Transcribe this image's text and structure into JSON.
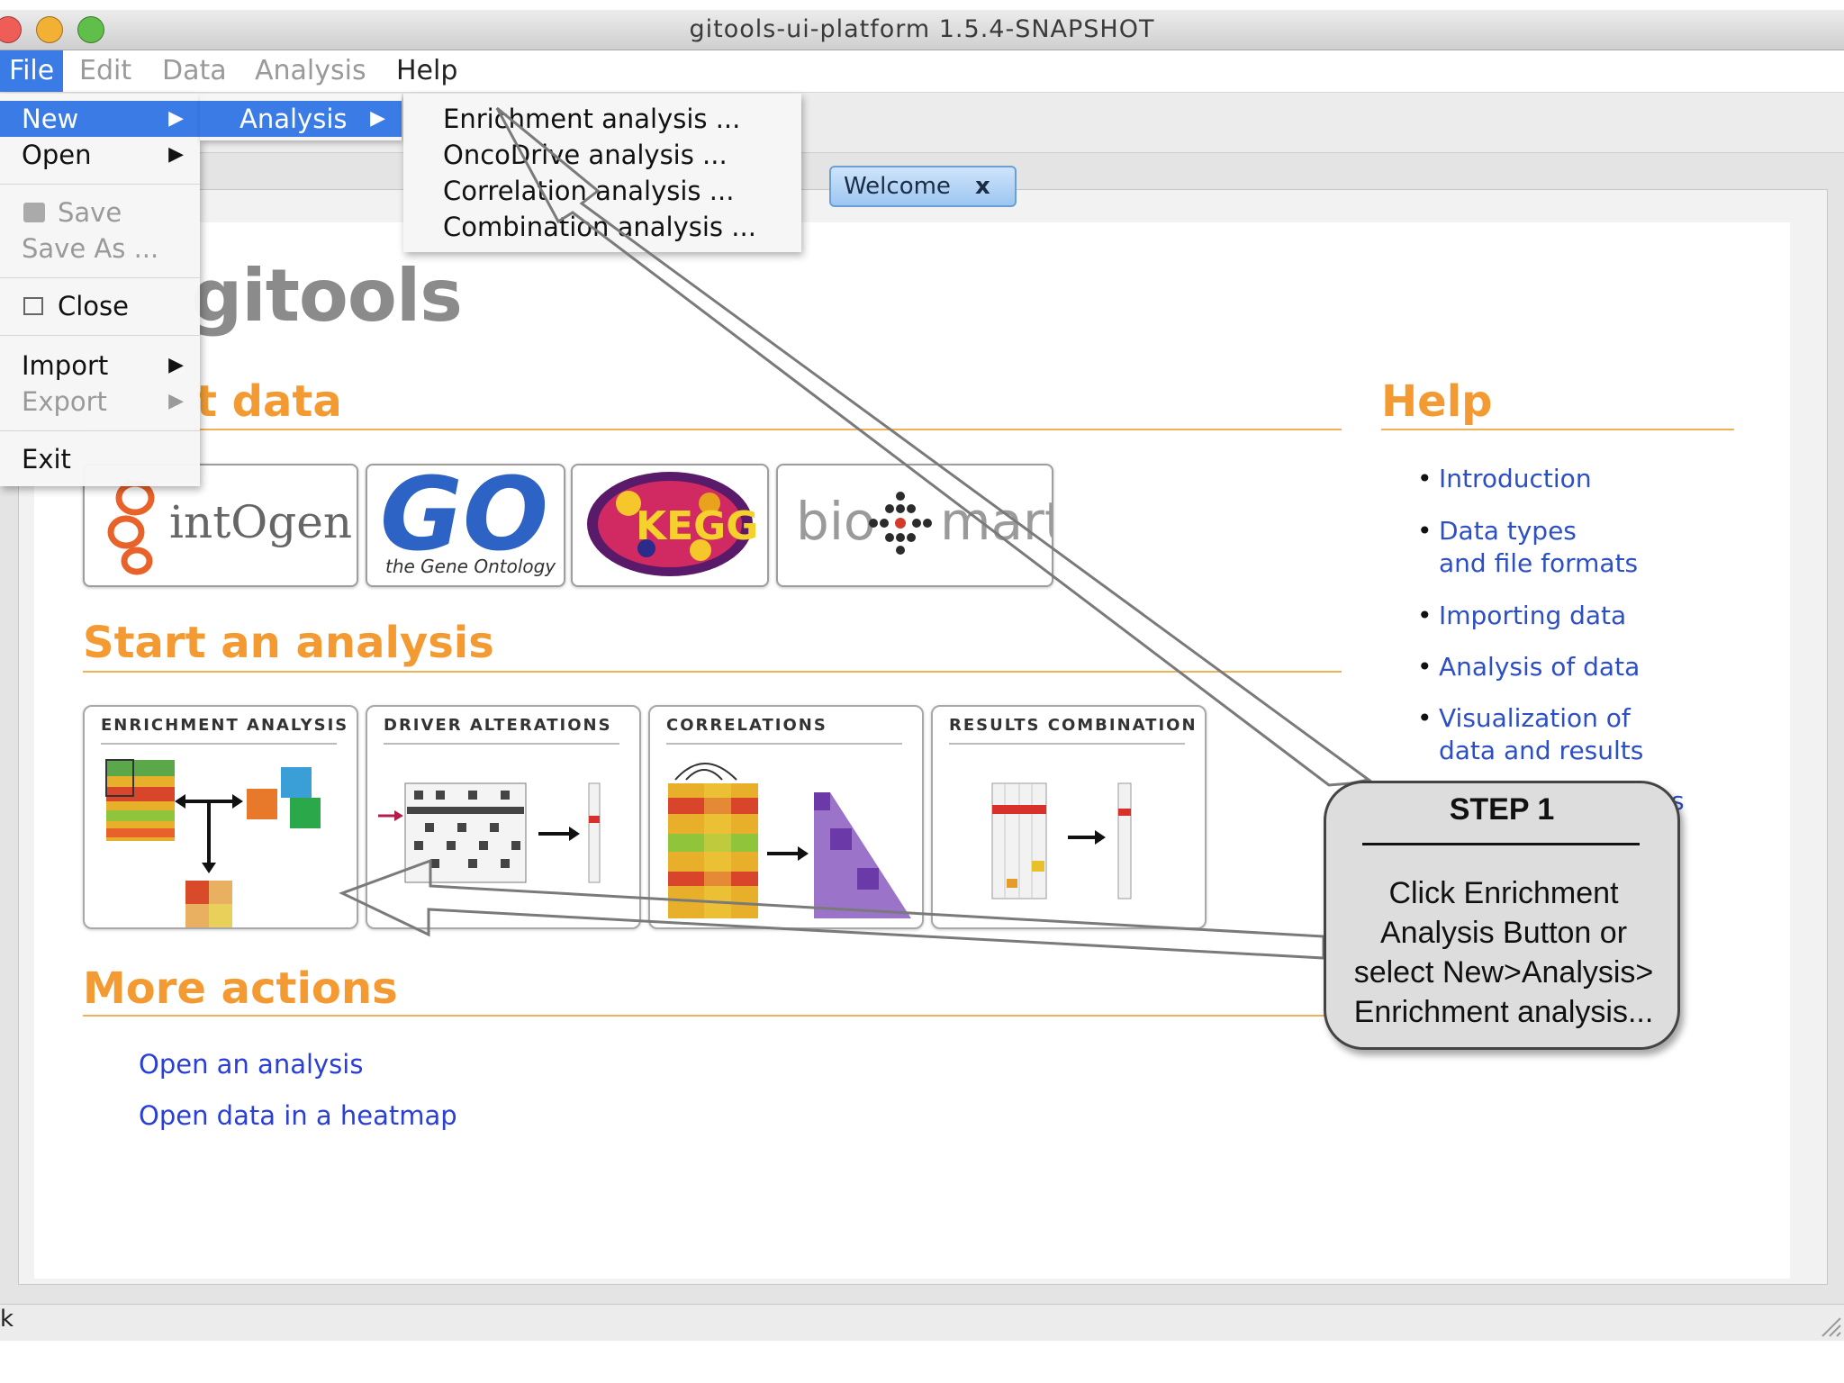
{
  "window": {
    "title": "gitools-ui-platform 1.5.4-SNAPSHOT"
  },
  "menubar": {
    "file": "File",
    "edit": "Edit",
    "data": "Data",
    "analysis": "Analysis",
    "help": "Help"
  },
  "file_menu": {
    "new": "New",
    "open": "Open",
    "save": "Save",
    "save_as": "Save As ...",
    "close": "Close",
    "import": "Import",
    "export": "Export",
    "exit": "Exit"
  },
  "submenu": {
    "analysis": "Analysis"
  },
  "analysis_menu": [
    "Enrichment analysis ...",
    "OncoDrive analysis ...",
    "Correlation analysis ...",
    "Combination analysis ..."
  ],
  "tab": {
    "label": "Welcome",
    "close": "x"
  },
  "logo": {
    "text": "gitools"
  },
  "sections": {
    "import": "t data",
    "start": "Start an analysis",
    "more": "More actions",
    "help": "Help"
  },
  "data_sources": {
    "intogen": "intOgen",
    "go": "GO",
    "go_sub": "the Gene Ontology",
    "kegg": "KEGG",
    "biomart_a": "bio",
    "biomart_b": "mart"
  },
  "analyses": [
    "Enrichment Analysis",
    "Driver Alterations",
    "Correlations",
    "Results combination"
  ],
  "help_links": [
    {
      "l1": "Introduction",
      "l2": ""
    },
    {
      "l1": "Data types",
      "l2": "and file formats"
    },
    {
      "l1": "Importing data",
      "l2": ""
    },
    {
      "l1": "Analysis of data",
      "l2": ""
    },
    {
      "l1": "Visualization of",
      "l2": "data and results"
    }
  ],
  "help_partial": "s",
  "more_actions": [
    "Open an analysis",
    "Open data in a heatmap"
  ],
  "callout": {
    "title": "STEP 1",
    "lines": [
      "Click Enrichment",
      "Analysis Button or",
      "select New>Analysis>",
      "Enrichment analysis..."
    ]
  },
  "statusbar": {
    "text": "k"
  },
  "colors": {
    "accent": "#f39b32",
    "link": "#2a3fd6",
    "menu_highlight": "#3a7be6"
  }
}
